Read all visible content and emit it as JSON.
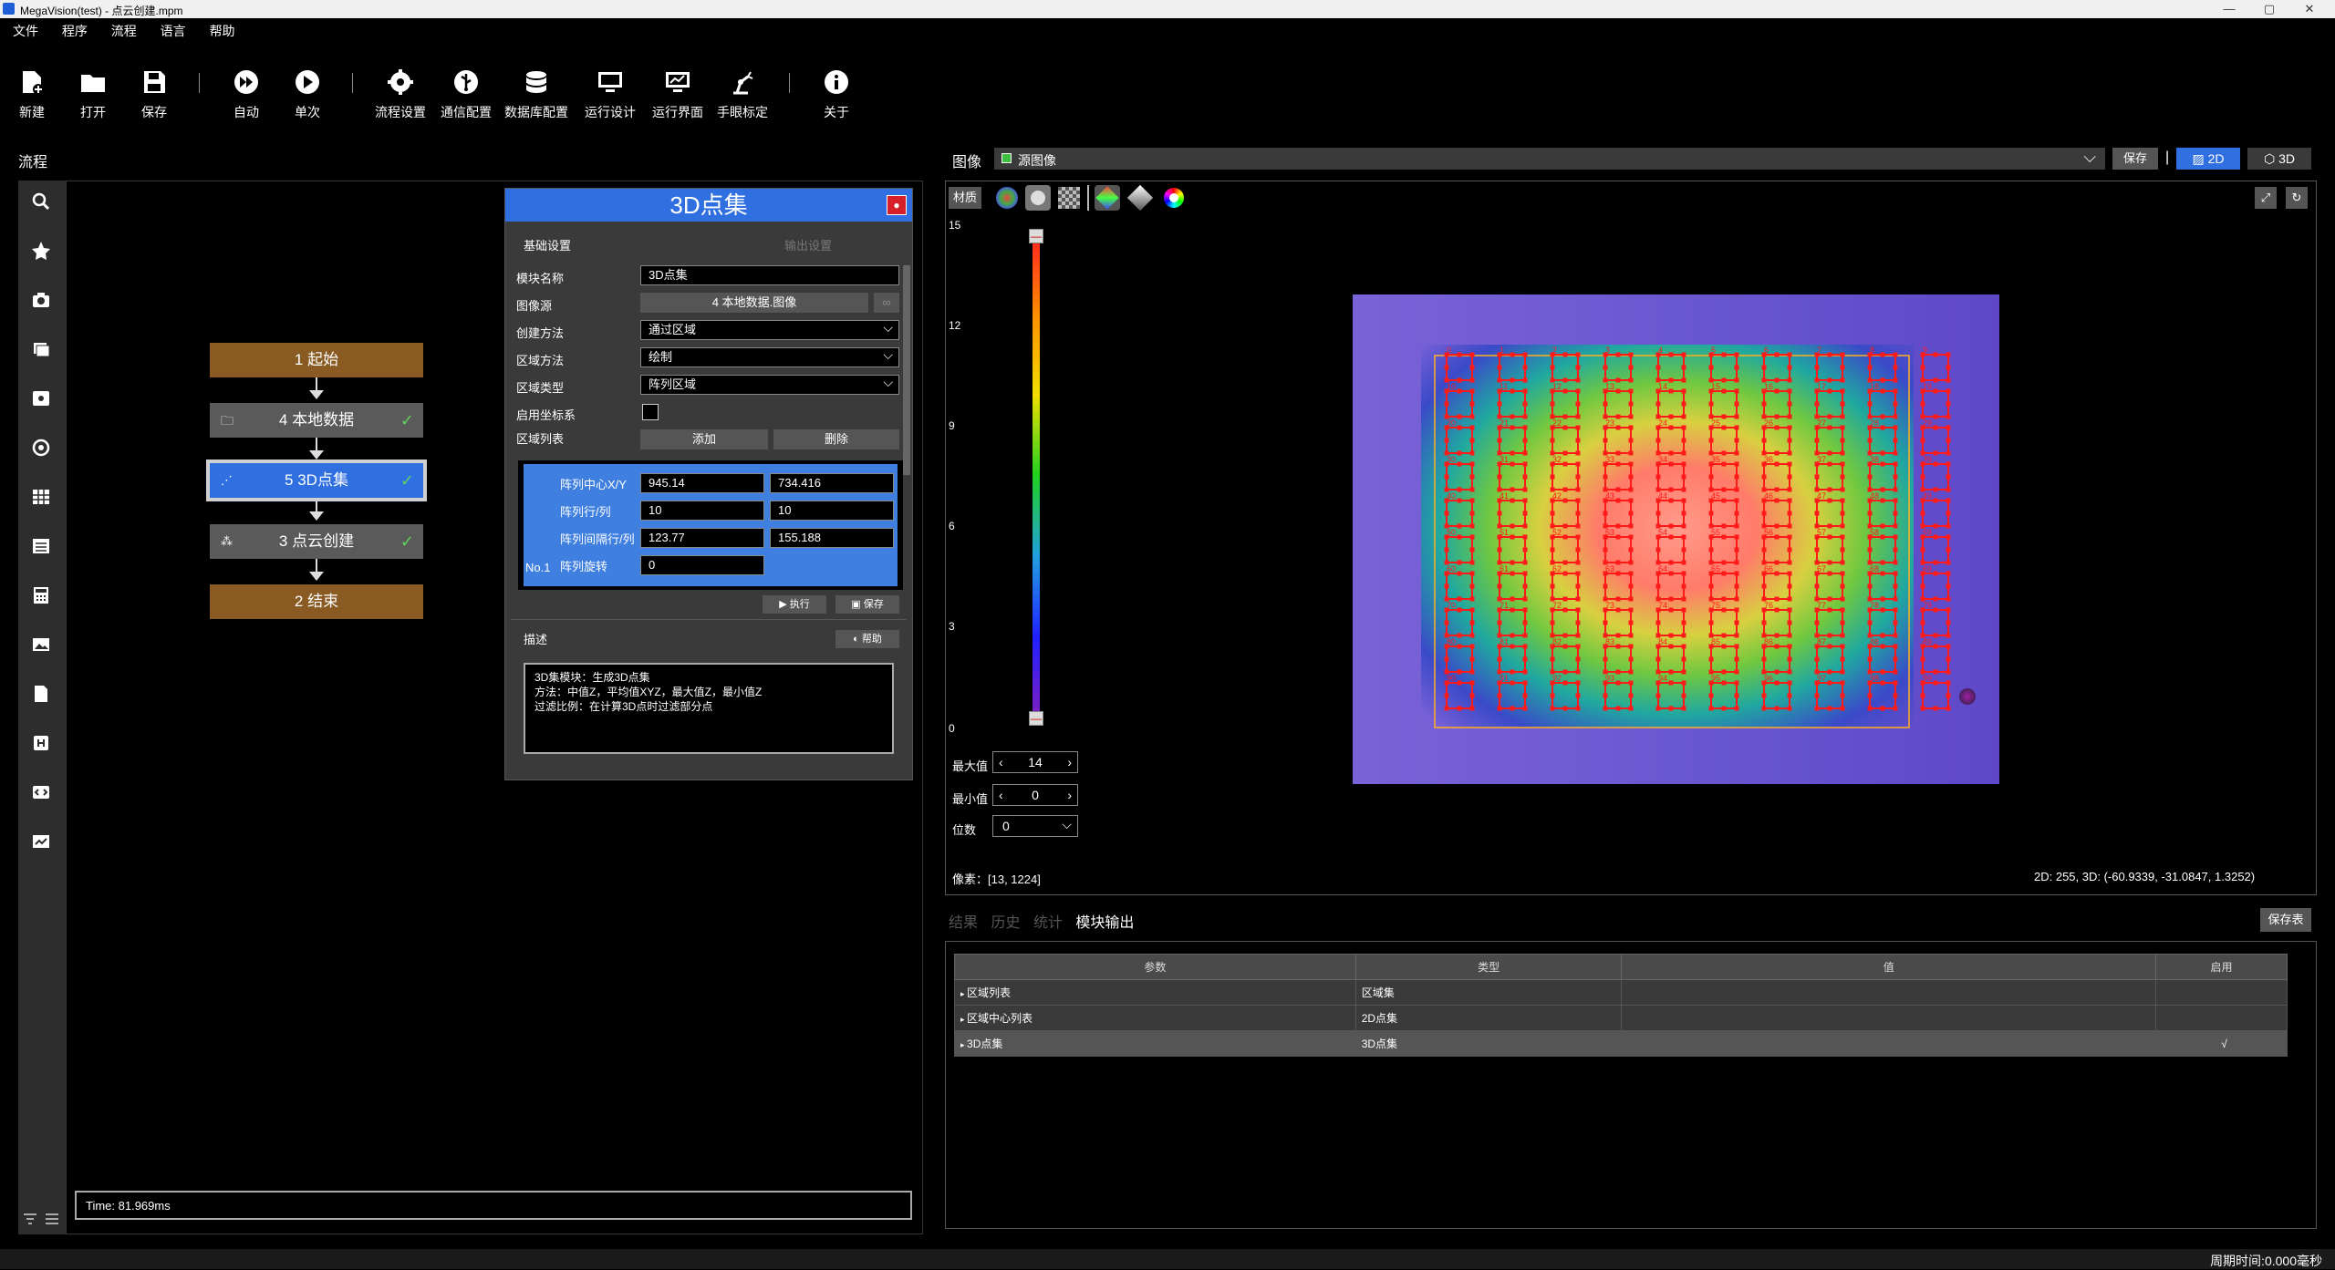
{
  "window": {
    "title": "MegaVision(test) - 点云创建.mpm",
    "min": "—",
    "max": "▢",
    "close": "✕"
  },
  "menu": [
    "文件",
    "程序",
    "流程",
    "语言",
    "帮助"
  ],
  "toolbar": [
    {
      "label": "新建",
      "icon": "new-file-icon"
    },
    {
      "label": "打开",
      "icon": "folder-open-icon"
    },
    {
      "label": "保存",
      "icon": "save-icon"
    },
    {
      "label": "自动",
      "icon": "fast-forward-icon"
    },
    {
      "label": "单次",
      "icon": "play-icon"
    },
    {
      "label": "流程设置",
      "icon": "gear-icon"
    },
    {
      "label": "通信配置",
      "icon": "usb-icon"
    },
    {
      "label": "数据库配置",
      "icon": "database-icon"
    },
    {
      "label": "运行设计",
      "icon": "monitor-icon"
    },
    {
      "label": "运行界面",
      "icon": "monitor-chart-icon"
    },
    {
      "label": "手眼标定",
      "icon": "robot-arm-icon"
    },
    {
      "label": "关于",
      "icon": "info-icon"
    }
  ],
  "flow": {
    "header": "流程",
    "nodes": [
      {
        "label": "1 起始",
        "style": "brown"
      },
      {
        "label": "4 本地数据",
        "style": "gray",
        "check": "✓"
      },
      {
        "label": "5 3D点集",
        "style": "blue",
        "check": "✓"
      },
      {
        "label": "3 点云创建",
        "style": "gray",
        "check": "✓"
      },
      {
        "label": "2 结束",
        "style": "brown"
      }
    ],
    "time": "Time: 81.969ms"
  },
  "dialog": {
    "title": "3D点集",
    "tab_basic": "基础设置",
    "tab_output": "输出设置",
    "module_name_label": "模块名称",
    "module_name": "3D点集",
    "image_source_label": "图像源",
    "image_source": "4 本地数据.图像",
    "link_btn": "∞",
    "create_method_label": "创建方法",
    "create_method": "通过区域",
    "region_method_label": "区域方法",
    "region_method": "绘制",
    "region_type_label": "区域类型",
    "region_type": "阵列区域",
    "coord_label": "启用坐标系",
    "region_list_label": "区域列表",
    "add_btn": "添加",
    "delete_btn": "删除",
    "array": {
      "center_label": "阵列中心X/Y",
      "center_x": "945.14",
      "center_y": "734.416",
      "rowcol_label": "阵列行/列",
      "rows": "10",
      "cols": "10",
      "spacing_label": "阵列间隔行/列",
      "spacing_r": "123.77",
      "spacing_c": "155.188",
      "rotate_label": "阵列旋转",
      "rotate": "0",
      "no": "No.1"
    },
    "run_btn": "执行",
    "save_btn": "保存",
    "desc_label": "描述",
    "help_btn": "帮助",
    "desc_lines": [
      "3D集模块：生成3D点集",
      "方法：中值Z，平均值XYZ，最大值Z，最小值Z",
      "过滤比例：在计算3D点时过滤部分点"
    ]
  },
  "image": {
    "header": "图像",
    "source": "源图像",
    "save_btn": "保存",
    "sep": "|",
    "mode_2d": "2D",
    "mode_3d": "3D",
    "material_btn": "材质",
    "scale_ticks": [
      "15",
      "12",
      "9",
      "6",
      "3",
      "0"
    ],
    "max_label": "最大值",
    "max_value": "14",
    "min_label": "最小值",
    "min_value": "0",
    "digits_label": "位数",
    "digits_value": "0",
    "pixel_info": "像素：[13, 1224]",
    "coord_info": "2D: 255, 3D: (-60.9339, -31.0847, 1.3252)",
    "grid_rows": 10,
    "grid_cols": 10
  },
  "results": {
    "tabs": [
      "结果",
      "历史",
      "统计",
      "模块输出"
    ],
    "save_table_btn": "保存表",
    "columns": [
      "参数",
      "类型",
      "值",
      "启用"
    ],
    "rows": [
      {
        "param": "区域列表",
        "type": "区域集",
        "value": "",
        "enabled": ""
      },
      {
        "param": "区域中心列表",
        "type": "2D点集",
        "value": "",
        "enabled": ""
      },
      {
        "param": "3D点集",
        "type": "3D点集",
        "value": "",
        "enabled": "√"
      }
    ]
  },
  "status": {
    "cycle_time": "周期时间:0.000毫秒"
  },
  "colors": {
    "accent": "#2f6fe0",
    "node_brown": "#8a5a23",
    "node_gray": "#5a5a5a",
    "point_red": "#ff1a1a"
  }
}
